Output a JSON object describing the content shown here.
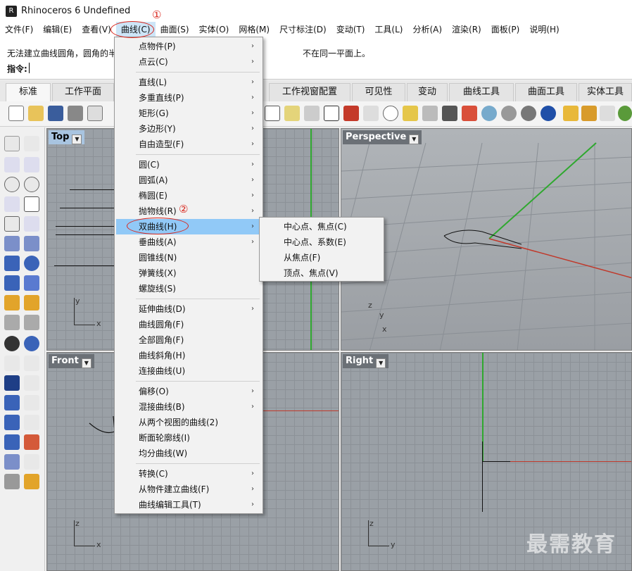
{
  "window": {
    "title": "Rhinoceros 6 Undefined"
  },
  "menubar": {
    "items": [
      "文件(F)",
      "编辑(E)",
      "查看(V)",
      "曲线(C)",
      "曲面(S)",
      "实体(O)",
      "网格(M)",
      "尺寸标注(D)",
      "变动(T)",
      "工具(L)",
      "分析(A)",
      "渲染(R)",
      "面板(P)",
      "说明(H)"
    ]
  },
  "command": {
    "history_line1": "无法建立曲线圆角，圆角的半",
    "history_line1_tail": "不在同一平面上。",
    "prompt_label": "指令:"
  },
  "tabs": [
    "标准",
    "工作平面",
    "工作视窗配置",
    "可见性",
    "变动",
    "曲线工具",
    "曲面工具",
    "实体工具"
  ],
  "viewports": {
    "top": "Top",
    "perspective": "Perspective",
    "front": "Front",
    "right": "Right"
  },
  "axes": {
    "x": "x",
    "y": "y",
    "z": "z"
  },
  "curve_menu": {
    "items": [
      {
        "label": "点物件(P)",
        "submenu": true
      },
      {
        "label": "点云(C)",
        "submenu": true
      },
      {
        "label": "直线(L)",
        "submenu": true
      },
      {
        "label": "多重直线(P)",
        "submenu": true
      },
      {
        "label": "矩形(G)",
        "submenu": true
      },
      {
        "label": "多边形(Y)",
        "submenu": true
      },
      {
        "label": "自由造型(F)",
        "submenu": true
      },
      {
        "label": "圆(C)",
        "submenu": true
      },
      {
        "label": "圆弧(A)",
        "submenu": true
      },
      {
        "label": "椭圆(E)",
        "submenu": true
      },
      {
        "label": "抛物线(R)",
        "submenu": true
      },
      {
        "label": "双曲线(H)",
        "submenu": true
      },
      {
        "label": "垂曲线(A)",
        "submenu": true
      },
      {
        "label": "圆锥线(N)",
        "submenu": false
      },
      {
        "label": "弹簧线(X)",
        "submenu": false
      },
      {
        "label": "螺旋线(S)",
        "submenu": false
      },
      {
        "label": "延伸曲线(D)",
        "submenu": true
      },
      {
        "label": "曲线圆角(F)",
        "submenu": false
      },
      {
        "label": "全部圆角(F)",
        "submenu": false
      },
      {
        "label": "曲线斜角(H)",
        "submenu": false
      },
      {
        "label": "连接曲线(U)",
        "submenu": false
      },
      {
        "label": "偏移(O)",
        "submenu": true
      },
      {
        "label": "混接曲线(B)",
        "submenu": true
      },
      {
        "label": "从两个视图的曲线(2)",
        "submenu": false
      },
      {
        "label": "断面轮廓线(I)",
        "submenu": false
      },
      {
        "label": "均分曲线(W)",
        "submenu": false
      },
      {
        "label": "转换(C)",
        "submenu": true
      },
      {
        "label": "从物件建立曲线(F)",
        "submenu": true
      },
      {
        "label": "曲线编辑工具(T)",
        "submenu": true
      }
    ]
  },
  "hyperbola_submenu": {
    "items": [
      "中心点、焦点(C)",
      "中心点、系数(E)",
      "从焦点(F)",
      "顶点、焦点(V)"
    ]
  },
  "annotations": {
    "step1": "①",
    "step2": "②"
  },
  "watermark": "最需教育",
  "colors": {
    "menu_highlight": "#91c9f7",
    "annotation_red": "#d9261c",
    "axis_green": "#2fa82f",
    "axis_red": "#c0392b"
  }
}
